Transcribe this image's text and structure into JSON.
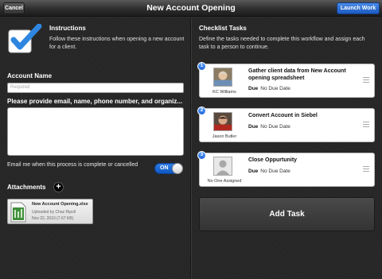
{
  "toolbar": {
    "cancel_label": "Cancel",
    "title": "New Account Opening",
    "launch_label": "Launch Work",
    "accent": "#2a6fd8"
  },
  "instructions": {
    "title": "Instructions",
    "text": "Follow these instructions when opening a new account for a client.",
    "icon": "checkbox-checked-icon"
  },
  "form": {
    "account_name_label": "Account Name",
    "account_name_placeholder": "Required",
    "details_label": "Please provide email, name, phone number, and organiz...",
    "details_value": "",
    "email_label": "Email me when this process is complete or cancelled",
    "email_toggle": "ON",
    "attachments_label": "Attachments"
  },
  "attachment": {
    "name": "New Account Opening.xlsx",
    "uploaded_by": "Uploaded by Chaz Ripoll",
    "date_size": "Nov 22, 2010 (7.67 KB)",
    "icon": "excel-file-icon"
  },
  "checklist": {
    "title": "Checklist Tasks",
    "description": "Define the tasks needed to complete this workflow and assign each task to a person to continue.",
    "due_label": "Due",
    "tasks": [
      {
        "number": "1",
        "title": "Gather client data from New Account opening spreadsheet",
        "due": "No Due Date",
        "assignee": "KC Williams"
      },
      {
        "number": "2",
        "title": "Convert Account in Siebel",
        "due": "No Due Date",
        "assignee": "Jason Butler"
      },
      {
        "number": "3",
        "title": "Close Oppurtunity",
        "due": "No Due Date",
        "assignee": "No One Assigned"
      }
    ],
    "add_task_label": "Add Task"
  }
}
